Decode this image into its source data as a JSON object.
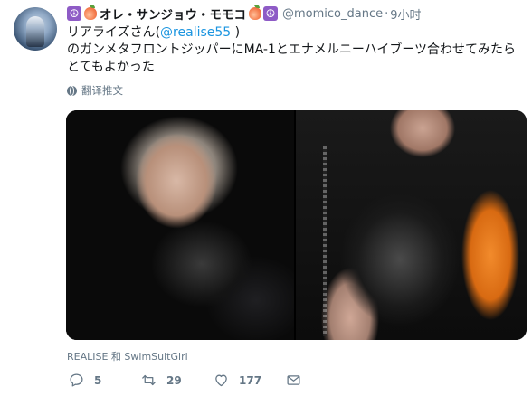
{
  "tweet": {
    "display_name": "オレ・サンジョウ・モモコ",
    "name_emojis_left": [
      "peace",
      "peach"
    ],
    "name_emojis_right": [
      "peach",
      "peace"
    ],
    "handle": "@momico_dance",
    "dot": "·",
    "time": "9小时",
    "text_line1_prefix": "リアライズさん(",
    "mention": "@realise55",
    "text_line1_suffix": " )",
    "text_line2": "のガンメタフロントジッパーにMA-1とエナメルニーハイブーツ合わせてみたら",
    "text_line3": "とてもよかった",
    "translate_label": "翻译推文"
  },
  "media": {
    "credit": "REALISE 和 SwimSuitGirl",
    "photo_count": 2
  },
  "actions": {
    "reply_count": "5",
    "retweet_count": "29",
    "like_count": "177"
  },
  "colors": {
    "link": "#1b95e0",
    "secondary": "#657786",
    "text": "#14171a"
  }
}
